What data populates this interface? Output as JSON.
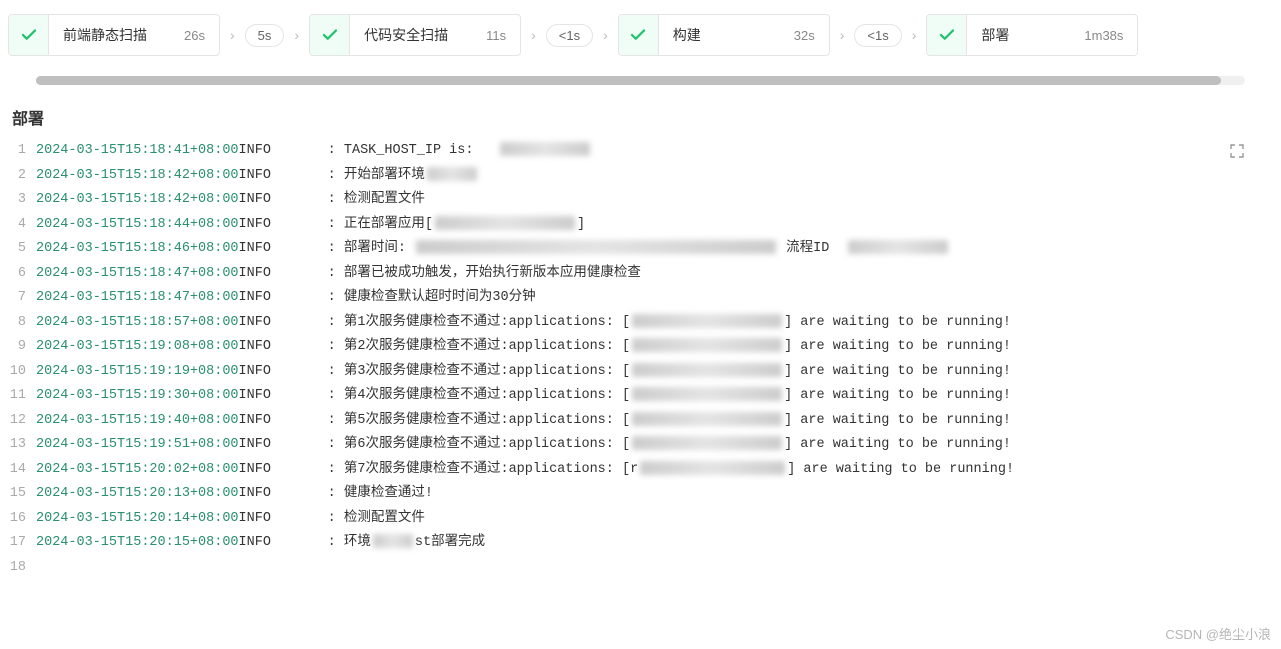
{
  "pipeline": {
    "stages": [
      {
        "name": "前端静态扫描",
        "duration": "26s",
        "after": "5s"
      },
      {
        "name": "代码安全扫描",
        "duration": "11s",
        "after": "<1s"
      },
      {
        "name": "构建",
        "duration": "32s",
        "after": "<1s"
      },
      {
        "name": "部署",
        "duration": "1m38s",
        "after": null
      }
    ]
  },
  "section": {
    "title": "部署"
  },
  "log": {
    "gap": "       ",
    "lines": [
      {
        "n": "1",
        "ts": "2024-03-15T15:18:41+08:00",
        "lvl": "INFO",
        "msg_pre": ": TASK_HOST_IP is:   ",
        "redact_w": 90,
        "msg_post": ""
      },
      {
        "n": "2",
        "ts": "2024-03-15T15:18:42+08:00",
        "lvl": "INFO",
        "msg_pre": ": 开始部署环境",
        "redact_w": 50,
        "msg_post": ""
      },
      {
        "n": "3",
        "ts": "2024-03-15T15:18:42+08:00",
        "lvl": "INFO",
        "msg_pre": ": 检测配置文件",
        "redact_w": 0,
        "msg_post": ""
      },
      {
        "n": "4",
        "ts": "2024-03-15T15:18:44+08:00",
        "lvl": "INFO",
        "msg_pre": ": 正在部署应用[",
        "redact_w": 140,
        "msg_post": "]"
      },
      {
        "n": "5",
        "ts": "2024-03-15T15:18:46+08:00",
        "lvl": "INFO",
        "msg_pre": ": 部署时间: ",
        "redact_w": 360,
        "msg_post": " 流程ID  ",
        "redact2_w": 100
      },
      {
        "n": "6",
        "ts": "2024-03-15T15:18:47+08:00",
        "lvl": "INFO",
        "msg_pre": ": 部署已被成功触发，开始执行新版本应用健康检查",
        "redact_w": 0,
        "msg_post": ""
      },
      {
        "n": "7",
        "ts": "2024-03-15T15:18:47+08:00",
        "lvl": "INFO",
        "msg_pre": ": 健康检查默认超时时间为30分钟",
        "redact_w": 0,
        "msg_post": ""
      },
      {
        "n": "8",
        "ts": "2024-03-15T15:18:57+08:00",
        "lvl": "INFO",
        "msg_pre": ": 第1次服务健康检查不通过:applications: [",
        "redact_w": 150,
        "msg_post": "] are waiting to be running!"
      },
      {
        "n": "9",
        "ts": "2024-03-15T15:19:08+08:00",
        "lvl": "INFO",
        "msg_pre": ": 第2次服务健康检查不通过:applications: [",
        "redact_w": 150,
        "msg_post": "] are waiting to be running!"
      },
      {
        "n": "10",
        "ts": "2024-03-15T15:19:19+08:00",
        "lvl": "INFO",
        "msg_pre": ": 第3次服务健康检查不通过:applications: [",
        "redact_w": 150,
        "msg_post": "] are waiting to be running!"
      },
      {
        "n": "11",
        "ts": "2024-03-15T15:19:30+08:00",
        "lvl": "INFO",
        "msg_pre": ": 第4次服务健康检查不通过:applications: [",
        "redact_w": 150,
        "msg_post": "] are waiting to be running!"
      },
      {
        "n": "12",
        "ts": "2024-03-15T15:19:40+08:00",
        "lvl": "INFO",
        "msg_pre": ": 第5次服务健康检查不通过:applications: [",
        "redact_w": 150,
        "msg_post": "] are waiting to be running!"
      },
      {
        "n": "13",
        "ts": "2024-03-15T15:19:51+08:00",
        "lvl": "INFO",
        "msg_pre": ": 第6次服务健康检查不通过:applications: [",
        "redact_w": 150,
        "msg_post": "] are waiting to be running!"
      },
      {
        "n": "14",
        "ts": "2024-03-15T15:20:02+08:00",
        "lvl": "INFO",
        "msg_pre": ": 第7次服务健康检查不通过:applications: [r",
        "redact_w": 145,
        "msg_post": "] are waiting to be running!"
      },
      {
        "n": "15",
        "ts": "2024-03-15T15:20:13+08:00",
        "lvl": "INFO",
        "msg_pre": ": 健康检查通过!",
        "redact_w": 0,
        "msg_post": ""
      },
      {
        "n": "16",
        "ts": "2024-03-15T15:20:14+08:00",
        "lvl": "INFO",
        "msg_pre": ": 检测配置文件",
        "redact_w": 0,
        "msg_post": ""
      },
      {
        "n": "17",
        "ts": "2024-03-15T15:20:15+08:00",
        "lvl": "INFO",
        "msg_pre": ": 环境",
        "redact_w": 40,
        "msg_post": "st部署完成"
      },
      {
        "n": "18",
        "ts": "",
        "lvl": "",
        "msg_pre": "",
        "redact_w": 0,
        "msg_post": ""
      }
    ]
  },
  "watermark": "CSDN @绝尘小浪"
}
